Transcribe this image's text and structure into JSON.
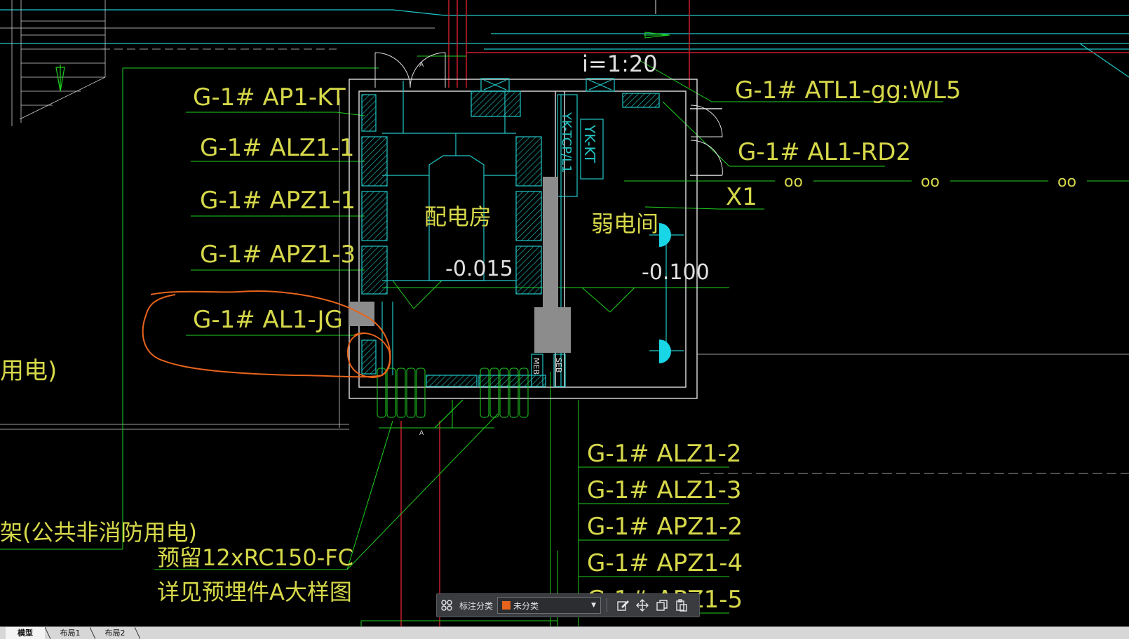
{
  "drawing": {
    "labels_left": [
      "G-1# AP1-KT",
      "G-1# ALZ1-1",
      "G-1# APZ1-1",
      "G-1# APZ1-3",
      "G-1# AL1-JG"
    ],
    "labels_right_bottom": [
      "G-1# ALZ1-2",
      "G-1# ALZ1-3",
      "G-1# APZ1-2",
      "G-1# APZ1-4",
      "G-1# APZ1-5"
    ],
    "labels_top_right": [
      "G-1# ATL1-gg:WL5",
      "G-1# AL1-RD2"
    ],
    "axis_x1": "X1",
    "slope": "i=1:20",
    "room_power": "配电房",
    "room_weak": "弱电间",
    "elev_power": "-0.015",
    "elev_weak": "-0.100",
    "vertical_yk_kt": "YK-KT",
    "vertical_yk_tcp": "YK-TCP/L1",
    "meb": "MEB",
    "seb": "SEB",
    "section_mark": "A",
    "note_left_partial": "用电)",
    "note_tray_partial": "架(公共非消防用电)",
    "note_reserve_1": "预留12xRC150-FC",
    "note_reserve_2": "详见预埋件A大样图",
    "axis_bubble_symbol": "oo"
  },
  "toolbar": {
    "label": "标注分类",
    "selected_value": "未分类",
    "selected_color": "#e8641c",
    "icons": [
      "annotation-grid-icon",
      "edit-icon",
      "move-icon",
      "copy-icon",
      "paste-icon"
    ]
  },
  "tabs": [
    "模型",
    "布局1",
    "布局2"
  ],
  "colors": {
    "background": "#000000",
    "text_yellow": "#d6d84a",
    "line_green": "#1fd11f",
    "line_cyan": "#22c7c7",
    "line_red": "#c81e2a",
    "line_white": "#e0e0e0",
    "markup_orange": "#e8641c"
  }
}
